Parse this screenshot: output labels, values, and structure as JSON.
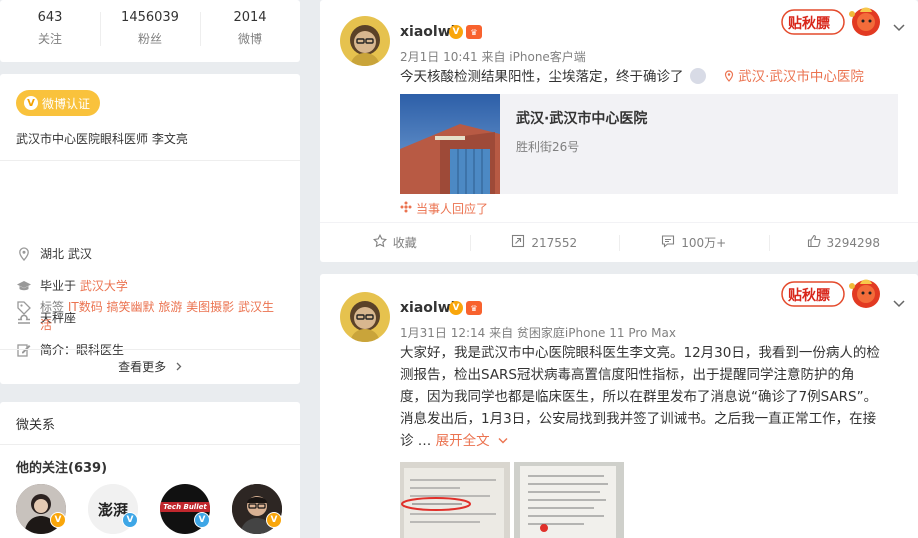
{
  "stats": [
    {
      "value": "643",
      "label": "关注"
    },
    {
      "value": "1456039",
      "label": "粉丝"
    },
    {
      "value": "2014",
      "label": "微博"
    }
  ],
  "profile": {
    "verify_badge": "微博认证",
    "verify_desc": "武汉市中心医院眼科医师 李文亮",
    "location": "湖北 武汉",
    "school_prefix": "毕业于",
    "school": "武汉大学",
    "constellation": "天秤座",
    "bio_label": "简介：",
    "bio": "眼科医生",
    "tags_label": "标签",
    "tags": "IT数码 搞笑幽默 旅游 美图摄影 武汉生活",
    "more": "查看更多",
    "icons": [
      "location-pin-icon",
      "graduation-cap-icon",
      "libra-icon",
      "edit-icon",
      "tag-icon"
    ]
  },
  "relations": {
    "title": "微关系",
    "following": "他的关注(639)",
    "avatar_texts": [
      "",
      "澎湃",
      "Tech Bullet",
      ""
    ]
  },
  "posts": [
    {
      "username": "xiaolwl",
      "meta": "2月1日 10:41 来自 iPhone客户端",
      "text": "今天核酸检测结果阳性，尘埃落定，终于确诊了",
      "location_link": "武汉·武汉市中心医院",
      "location_card": {
        "title": "武汉·武汉市中心医院",
        "subtitle": "胜利街26号"
      },
      "replied": "当事人回应了",
      "sticker": "贴秋膘",
      "actions": {
        "favorite": "收藏",
        "repost": "217552",
        "comment": "100万+",
        "like": "3294298"
      }
    },
    {
      "username": "xiaolwl",
      "meta": "1月31日 12:14 来自 贫困家庭iPhone 11 Pro Max",
      "text_lines": [
        "大家好，我是武汉市中心医院眼科医生李文亮。12月30日，我看到一份病人的检",
        "测报告，检出SARS冠状病毒高置信度阳性指标，出于提醒同学注意防护的角",
        "度，因为我同学也都是临床医生，所以在群里发布了消息说“确诊了7例SARS”。",
        "消息发出后，1月3日，公安局找到我并签了训诫书。之后我一直正常工作，在接"
      ],
      "last_line": "诊 … ",
      "expand": "展开全文",
      "sticker": "贴秋膘"
    }
  ],
  "colors": {
    "accent": "#eb7350",
    "verify": "#f9c23c",
    "bg": "#e9ecef"
  }
}
